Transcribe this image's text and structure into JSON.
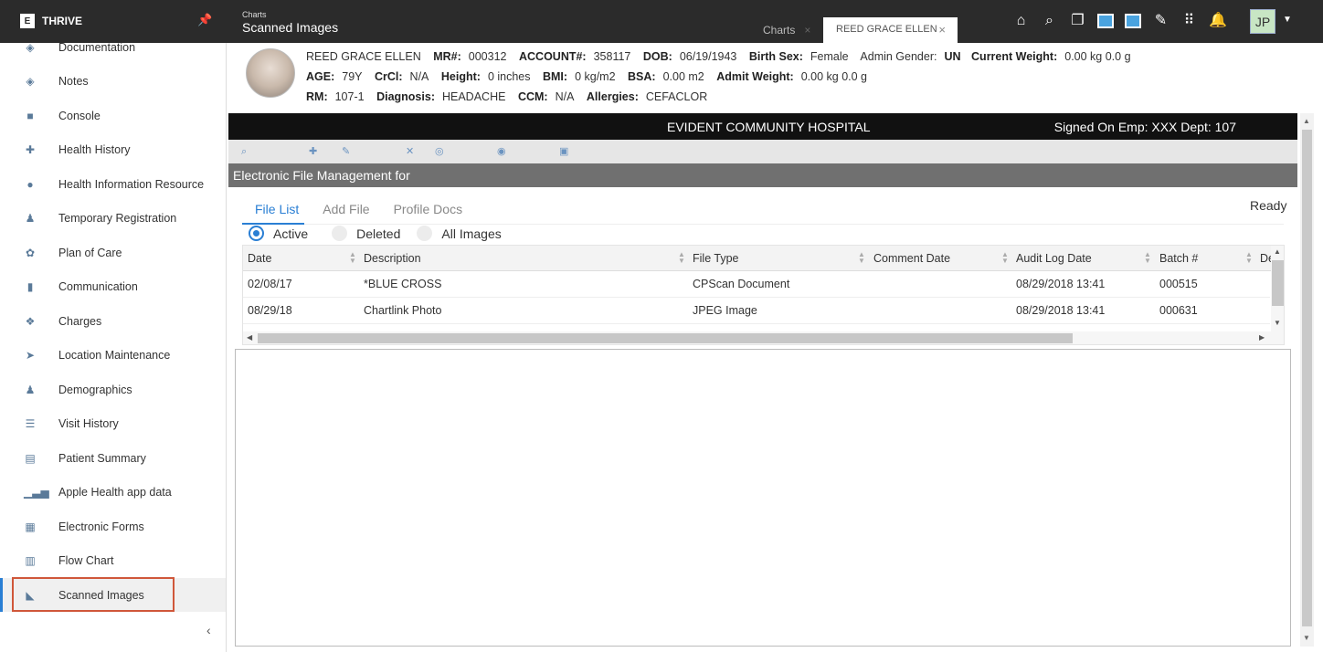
{
  "app": {
    "name": "THRIVE",
    "logo_text": "E"
  },
  "breadcrumb": {
    "parent": "Charts",
    "current": "Scanned Images"
  },
  "tabs": [
    {
      "label": "Charts",
      "active": false
    },
    {
      "label": "REED GRACE ELLEN",
      "active": true
    }
  ],
  "user": {
    "initials": "JP"
  },
  "sidebar": {
    "items": [
      {
        "label": "Documentation",
        "icon": "documentation-icon"
      },
      {
        "label": "Notes",
        "icon": "notes-icon"
      },
      {
        "label": "Console",
        "icon": "console-icon"
      },
      {
        "label": "Health History",
        "icon": "health-history-icon"
      },
      {
        "label": "Health Information Resource",
        "icon": "globe-icon"
      },
      {
        "label": "Temporary Registration",
        "icon": "person-icon"
      },
      {
        "label": "Plan of Care",
        "icon": "plan-of-care-icon"
      },
      {
        "label": "Communication",
        "icon": "phone-icon"
      },
      {
        "label": "Charges",
        "icon": "charges-icon"
      },
      {
        "label": "Location Maintenance",
        "icon": "location-icon"
      },
      {
        "label": "Demographics",
        "icon": "demographics-icon"
      },
      {
        "label": "Visit History",
        "icon": "visit-history-icon"
      },
      {
        "label": "Patient Summary",
        "icon": "patient-summary-icon"
      },
      {
        "label": "Apple Health app data",
        "icon": "bar-chart-icon"
      },
      {
        "label": "Electronic Forms",
        "icon": "forms-icon"
      },
      {
        "label": "Flow Chart",
        "icon": "flow-chart-icon"
      },
      {
        "label": "Scanned Images",
        "icon": "scanner-icon",
        "active": true
      }
    ],
    "collapse_glyph": "‹"
  },
  "patient": {
    "name": "REED GRACE ELLEN",
    "mr_label": "MR#:",
    "mr": "000312",
    "account_label": "ACCOUNT#:",
    "account": "358117",
    "dob_label": "DOB:",
    "dob": "06/19/1943",
    "sex_label": "Birth Sex:",
    "sex": "Female",
    "gender_label": "Admin Gender:",
    "gender": "UN",
    "weight_label": "Current Weight:",
    "weight": "0.00 kg 0.0 g",
    "age_label": "AGE:",
    "age": "79Y",
    "crcl_label": "CrCl:",
    "crcl": "N/A",
    "height_label": "Height:",
    "height": "0 inches",
    "bmi_label": "BMI:",
    "bmi": "0 kg/m2",
    "bsa_label": "BSA:",
    "bsa": "0.00 m2",
    "admit_weight_label": "Admit Weight:",
    "admit_weight": "0.00 kg 0.0 g",
    "rm_label": "RM:",
    "rm": "107-1",
    "diagnosis_label": "Diagnosis:",
    "diagnosis": "HEADACHE",
    "ccm_label": "CCM:",
    "ccm": "N/A",
    "allergies_label": "Allergies:",
    "allergies": "CEFACLOR"
  },
  "hospital": {
    "name": "EVIDENT COMMUNITY HOSPITAL",
    "signed_on": "Signed On Emp: XXX Dept: 107"
  },
  "efm": {
    "title": "Electronic File Management for"
  },
  "subtabs": [
    "File List",
    "Add File",
    "Profile Docs"
  ],
  "status": "Ready",
  "filters": [
    "Active",
    "Deleted",
    "All Images"
  ],
  "grid": {
    "columns": [
      "Date",
      "Description",
      "File Type",
      "Comment Date",
      "Audit Log Date",
      "Batch #",
      "De"
    ],
    "rows": [
      [
        "02/08/17",
        "*BLUE CROSS",
        "CPScan Document",
        "",
        "08/29/2018 13:41",
        "000515"
      ],
      [
        "08/29/18",
        "Chartlink Photo",
        "JPEG Image",
        "",
        "08/29/2018 13:41",
        "000631"
      ]
    ]
  }
}
